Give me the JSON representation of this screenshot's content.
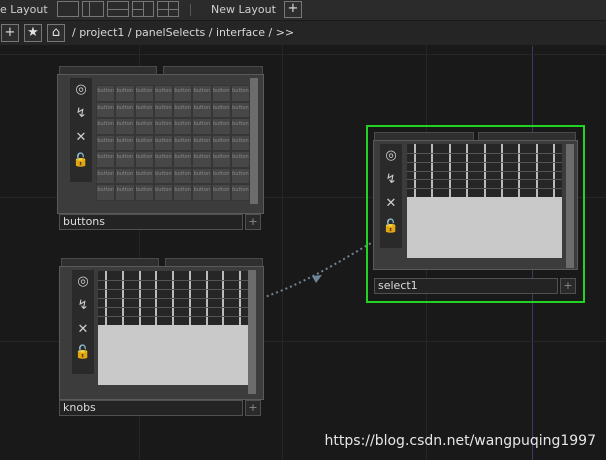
{
  "topbar": {
    "layout_label": "e Layout",
    "new_layout_label": "New Layout",
    "add_glyph": "+"
  },
  "pathbar": {
    "path": "/ project1 / panelSelects / interface / >>",
    "add_glyph": "+",
    "star_glyph": "★",
    "home_glyph": "⌂"
  },
  "icons": {
    "viewer": "◎",
    "activate": "↯",
    "bypass": "✕",
    "lock": "🔓"
  },
  "nodes": {
    "buttons": {
      "label": "buttons",
      "cell_text": "button",
      "rows": 7,
      "cols": 8,
      "plus": "+"
    },
    "knobs": {
      "label": "knobs",
      "plus": "+",
      "columns": 9
    },
    "select1": {
      "label": "select1",
      "plus": "+",
      "columns": 9,
      "selected": true
    }
  },
  "colors": {
    "selected_border": "#22d322",
    "wire": "#6e8597"
  },
  "watermark": "https://blog.csdn.net/wangpuqing1997"
}
